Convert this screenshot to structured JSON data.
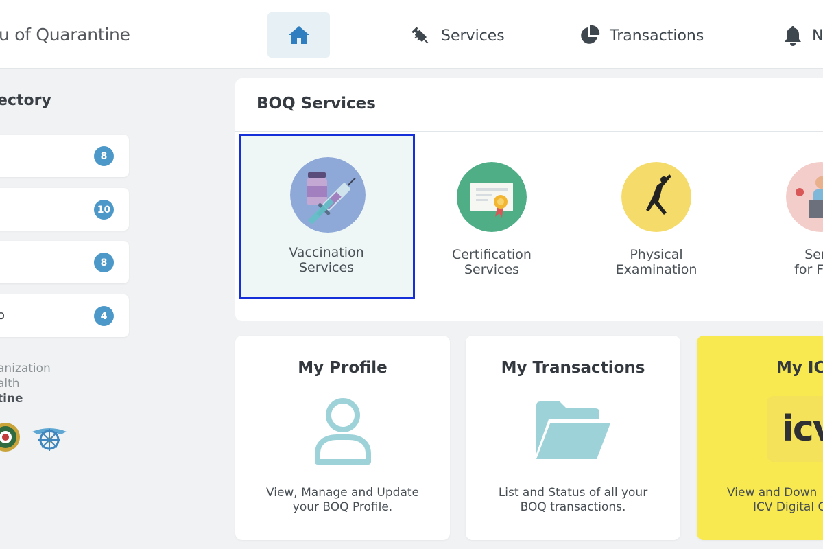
{
  "header": {
    "brand": "u of Quarantine",
    "nav": {
      "services": "Services",
      "transactions": "Transactions",
      "notifications": "N"
    }
  },
  "sidebar": {
    "title": "ectory",
    "items": [
      {
        "label": "",
        "count": "8"
      },
      {
        "label": "",
        "count": "10"
      },
      {
        "label": "",
        "count": "8"
      },
      {
        "label": "o",
        "count": "4"
      }
    ],
    "org_lines": [
      "anization",
      "alth",
      "tine"
    ]
  },
  "services_panel": {
    "title": "BOQ Services",
    "items": [
      {
        "line1": "Vaccination",
        "line2": "Services",
        "icon": "vaccine-icon"
      },
      {
        "line1": "Certification",
        "line2": "Services",
        "icon": "certificate-icon"
      },
      {
        "line1": "Physical",
        "line2": "Examination",
        "icon": "exercise-icon"
      },
      {
        "line1": "Semi",
        "line2": "for Food",
        "icon": "seminar-icon"
      }
    ]
  },
  "cards": {
    "profile": {
      "title": "My Profile",
      "line1": "View, Manage and Update",
      "line2": "your BOQ Profile."
    },
    "transactions": {
      "title": "My Transactions",
      "line1": "List and Status of all your",
      "line2": "BOQ transactions."
    },
    "icv": {
      "title": "My ICV",
      "logo": "icv",
      "line1": "View and Down",
      "line2": "ICV Digital C"
    }
  },
  "colors": {
    "accent": "#4c98c9",
    "selection_border": "#1530d9",
    "icv_yellow": "#f7e94f",
    "icon_teal": "#9ed2d9"
  }
}
